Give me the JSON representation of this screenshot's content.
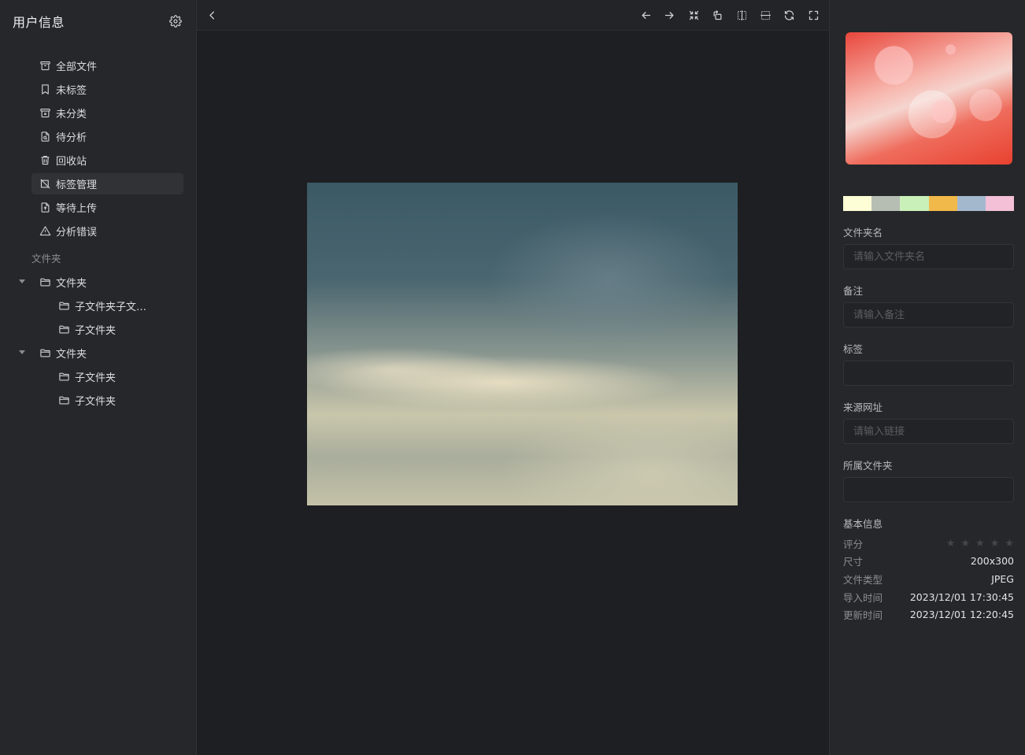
{
  "sidebar": {
    "title": "用户信息",
    "nav": [
      {
        "label": "全部文件",
        "icon": "archive-icon"
      },
      {
        "label": "未标签",
        "icon": "bookmark-icon"
      },
      {
        "label": "未分类",
        "icon": "archive-x-icon"
      },
      {
        "label": "待分析",
        "icon": "file-search-icon"
      },
      {
        "label": "回收站",
        "icon": "trash-icon"
      },
      {
        "label": "标签管理",
        "icon": "tag-off-icon"
      },
      {
        "label": "等待上传",
        "icon": "file-upload-icon"
      },
      {
        "label": "分析错误",
        "icon": "warning-icon"
      }
    ],
    "active_index": 5,
    "folders_label": "文件夹",
    "folders": [
      {
        "label": "文件夹",
        "children": [
          "子文件夹子文件夹",
          "子文件夹"
        ]
      },
      {
        "label": "文件夹",
        "children": [
          "子文件夹",
          "子文件夹"
        ]
      }
    ]
  },
  "toolbar": {
    "buttons": [
      "back-icon",
      "prev-icon",
      "next-icon",
      "fit-icon",
      "rotate-icon",
      "split-vertical-icon",
      "split-horizontal-icon",
      "refresh-icon",
      "fullscreen-icon"
    ]
  },
  "panel": {
    "palette": [
      "#fdfed6",
      "#b6beb4",
      "#c9f0b9",
      "#f1b94a",
      "#a4b8cd",
      "#f3c0d7"
    ],
    "fields": {
      "folder_name": {
        "label": "文件夹名",
        "placeholder": "请输入文件夹名",
        "value": ""
      },
      "note": {
        "label": "备注",
        "placeholder": "请输入备注",
        "value": ""
      },
      "tags": {
        "label": "标签",
        "placeholder": "",
        "value": ""
      },
      "source_url": {
        "label": "来源网址",
        "placeholder": "请输入链接",
        "value": ""
      },
      "folder": {
        "label": "所属文件夹",
        "placeholder": "",
        "value": ""
      }
    },
    "basic_info": {
      "title": "基本信息",
      "rating_label": "评分",
      "rating": 0,
      "rating_max": 5,
      "size_label": "尺寸",
      "size": "200x300",
      "type_label": "文件类型",
      "type": "JPEG",
      "imported_label": "导入时间",
      "imported": "2023/12/01 17:30:45",
      "updated_label": "更新时间",
      "updated": "2023/12/01 12:20:45"
    }
  }
}
